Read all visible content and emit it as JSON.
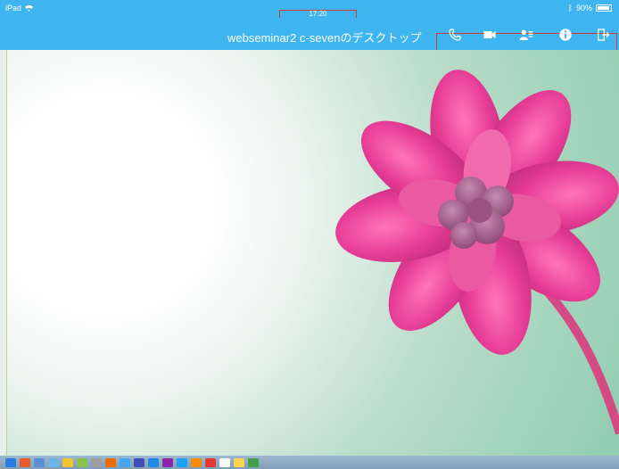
{
  "status_bar": {
    "carrier": "iPad",
    "time": "17:20",
    "battery_text": "90%"
  },
  "header": {
    "title": "webseminar2 c-sevenのデスクトップ"
  },
  "toolbar": {
    "icons": [
      "phone-icon",
      "video-camera-icon",
      "participants-icon",
      "info-icon",
      "exit-icon"
    ]
  },
  "desktop": {
    "wallpaper": "pink flower on light green background"
  },
  "taskbar": {
    "icons": [
      "start-icon",
      "office-icon",
      "outlook-icon",
      "explorer-icon",
      "chrome-icon",
      "paint-icon",
      "gimp-icon",
      "firefox-icon",
      "task-icon",
      "vm-icon",
      "display-icon",
      "folder-icon",
      "skype-icon",
      "app-icon",
      "media-icon",
      "pdf-icon",
      "folder-2-icon",
      "app-2-icon"
    ]
  },
  "colors": {
    "accent": "#3eb5ee",
    "highlight": "#d43b36"
  }
}
